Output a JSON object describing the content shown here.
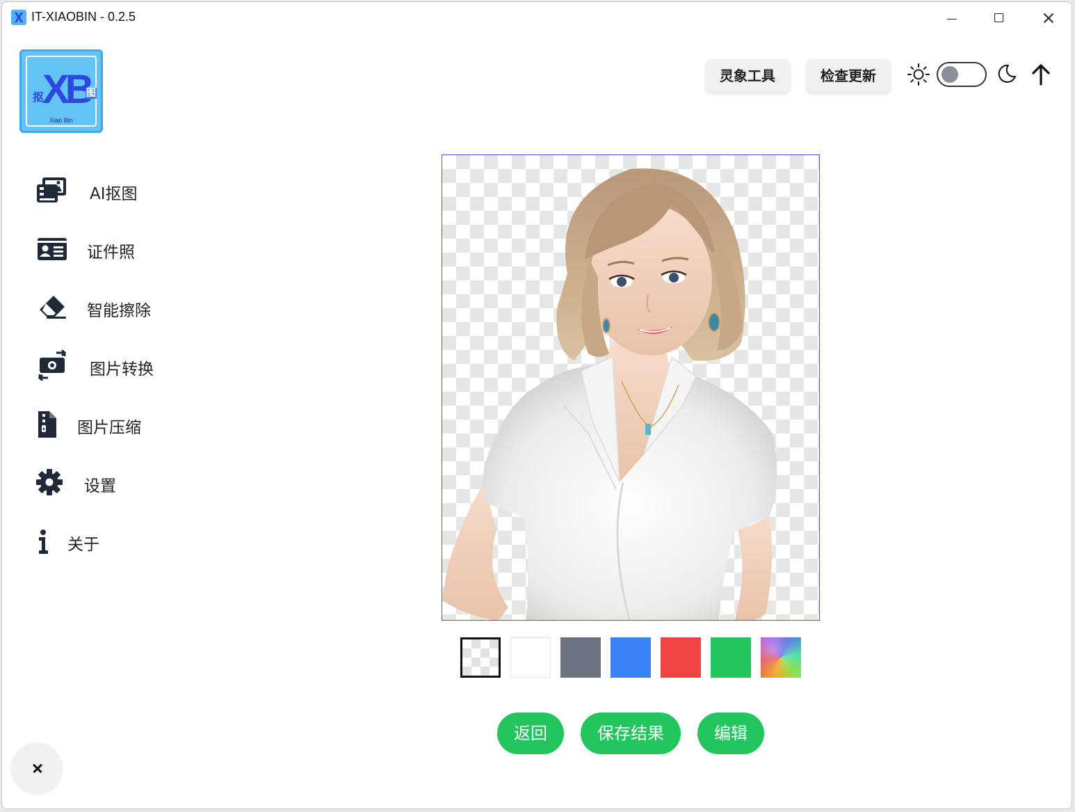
{
  "window": {
    "title": "IT-XIAOBIN - 0.2.5"
  },
  "logo": {
    "main": "XB",
    "left_char": "抠",
    "right_char": "图",
    "sub": "Xiao Bin"
  },
  "header": {
    "lingxiang_label": "灵象工具",
    "update_label": "检查更新",
    "theme_toggle_on": false
  },
  "nav": {
    "items": [
      {
        "label": "AI抠图",
        "icon": "images-icon"
      },
      {
        "label": "证件照",
        "icon": "id-card-icon"
      },
      {
        "label": "智能擦除",
        "icon": "eraser-icon"
      },
      {
        "label": "图片转换",
        "icon": "money-bill-transfer-icon"
      },
      {
        "label": "图片压缩",
        "icon": "file-zipper-icon"
      },
      {
        "label": "设置",
        "icon": "gear-icon"
      },
      {
        "label": "关于",
        "icon": "info-icon"
      }
    ]
  },
  "background_options": [
    {
      "name": "transparent",
      "color": "transparent",
      "selected": true
    },
    {
      "name": "white",
      "color": "#ffffff",
      "selected": false
    },
    {
      "name": "gray",
      "color": "#6b7280",
      "selected": false
    },
    {
      "name": "blue",
      "color": "#3b82f6",
      "selected": false
    },
    {
      "name": "red",
      "color": "#ef4444",
      "selected": false
    },
    {
      "name": "green",
      "color": "#22c55e",
      "selected": false
    },
    {
      "name": "custom",
      "color": "gradient",
      "selected": false
    }
  ],
  "actions": {
    "back_label": "返回",
    "save_label": "保存结果",
    "edit_label": "编辑",
    "button_color": "#22c55e"
  },
  "colors": {
    "accent": "#22c55e",
    "frame_border": "#5b4fe0",
    "logo_bg": "#64c3f5"
  }
}
